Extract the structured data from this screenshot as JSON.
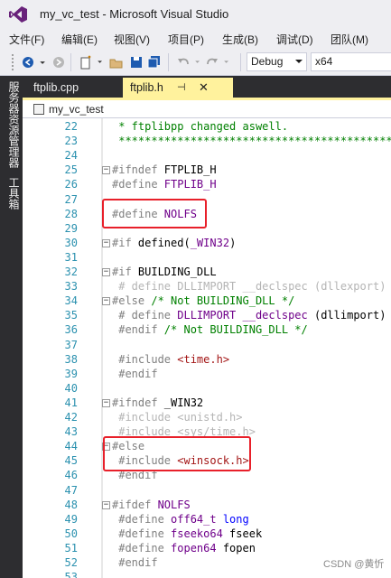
{
  "window": {
    "title": "my_vc_test - Microsoft Visual Studio"
  },
  "menu": [
    {
      "label": "文件(F)"
    },
    {
      "label": "编辑(E)"
    },
    {
      "label": "视图(V)"
    },
    {
      "label": "项目(P)"
    },
    {
      "label": "生成(B)"
    },
    {
      "label": "调试(D)"
    },
    {
      "label": "团队(M)"
    }
  ],
  "toolbar": {
    "config_value": "Debug",
    "platform_value": "x64"
  },
  "side_tabs": [
    {
      "label": "服务器资源管理器"
    },
    {
      "label": "工具箱"
    }
  ],
  "tabs": [
    {
      "label": "ftplib.cpp"
    },
    {
      "label": "ftplib.h"
    }
  ],
  "nav": {
    "scope": "my_vc_test"
  },
  "colors": {
    "tab_active": "#fff29d",
    "highlight_box": "#e8202a",
    "line_number": "#2b91af"
  },
  "code": [
    {
      "n": "22",
      "fold": "",
      "tokens": [
        {
          "c": "cm",
          "t": " * ftplibpp changed aswell."
        }
      ]
    },
    {
      "n": "23",
      "fold": "",
      "tokens": [
        {
          "c": "cm",
          "t": " ****************************************************"
        }
      ]
    },
    {
      "n": "24",
      "fold": "",
      "tokens": []
    },
    {
      "n": "25",
      "fold": "−",
      "tokens": [
        {
          "c": "pp",
          "t": "#ifndef "
        },
        {
          "c": "plain",
          "t": "FTPLIB_H"
        }
      ]
    },
    {
      "n": "26",
      "fold": "",
      "tokens": [
        {
          "c": "pp",
          "t": "#define "
        },
        {
          "c": "id",
          "t": "FTPLIB_H"
        }
      ]
    },
    {
      "n": "27",
      "fold": "",
      "tokens": []
    },
    {
      "n": "28",
      "fold": "",
      "tokens": [
        {
          "c": "pp",
          "t": "#define "
        },
        {
          "c": "id",
          "t": "NOLFS"
        }
      ]
    },
    {
      "n": "29",
      "fold": "",
      "tokens": []
    },
    {
      "n": "30",
      "fold": "−",
      "tokens": [
        {
          "c": "pp",
          "t": "#if "
        },
        {
          "c": "plain",
          "t": "defined("
        },
        {
          "c": "id",
          "t": "_WIN32"
        },
        {
          "c": "plain",
          "t": ")"
        }
      ]
    },
    {
      "n": "31",
      "fold": "",
      "tokens": []
    },
    {
      "n": "32",
      "fold": "−",
      "tokens": [
        {
          "c": "pp",
          "t": "#if "
        },
        {
          "c": "plain",
          "t": "BUILDING_DLL"
        }
      ]
    },
    {
      "n": "33",
      "fold": "",
      "tokens": [
        {
          "c": "dim",
          "t": " # define DLLIMPORT __declspec (dllexport)"
        }
      ]
    },
    {
      "n": "34",
      "fold": "−",
      "tokens": [
        {
          "c": "pp",
          "t": "#else "
        },
        {
          "c": "cm",
          "t": "/* Not BUILDING_DLL */"
        }
      ]
    },
    {
      "n": "35",
      "fold": "",
      "tokens": [
        {
          "c": "pp",
          "t": " # define "
        },
        {
          "c": "id",
          "t": "DLLIMPORT __declspec"
        },
        {
          "c": "plain",
          "t": " (dllimport)"
        }
      ]
    },
    {
      "n": "36",
      "fold": "",
      "tokens": [
        {
          "c": "pp",
          "t": " #endif "
        },
        {
          "c": "cm",
          "t": "/* Not BUILDING_DLL */"
        }
      ]
    },
    {
      "n": "37",
      "fold": "",
      "tokens": []
    },
    {
      "n": "38",
      "fold": "",
      "tokens": [
        {
          "c": "pp",
          "t": " #include "
        },
        {
          "c": "inc",
          "t": "<time.h>"
        }
      ]
    },
    {
      "n": "39",
      "fold": "",
      "tokens": [
        {
          "c": "pp",
          "t": " #endif"
        }
      ]
    },
    {
      "n": "40",
      "fold": "",
      "tokens": []
    },
    {
      "n": "41",
      "fold": "−",
      "tokens": [
        {
          "c": "pp",
          "t": "#ifndef "
        },
        {
          "c": "plain",
          "t": "_WIN32"
        }
      ]
    },
    {
      "n": "42",
      "fold": "",
      "tokens": [
        {
          "c": "dim",
          "t": " #include <unistd.h>"
        }
      ]
    },
    {
      "n": "43",
      "fold": "",
      "tokens": [
        {
          "c": "dim",
          "t": " #include <sys/time.h>"
        }
      ]
    },
    {
      "n": "44",
      "fold": "−",
      "tokens": [
        {
          "c": "pp",
          "t": "#else"
        }
      ]
    },
    {
      "n": "45",
      "fold": "",
      "tokens": [
        {
          "c": "pp",
          "t": " #include "
        },
        {
          "c": "inc",
          "t": "<winsock.h>"
        }
      ]
    },
    {
      "n": "46",
      "fold": "",
      "tokens": [
        {
          "c": "pp",
          "t": " #endif"
        }
      ]
    },
    {
      "n": "47",
      "fold": "",
      "tokens": []
    },
    {
      "n": "48",
      "fold": "−",
      "tokens": [
        {
          "c": "pp",
          "t": "#ifdef "
        },
        {
          "c": "id",
          "t": "NOLFS"
        }
      ]
    },
    {
      "n": "49",
      "fold": "",
      "tokens": [
        {
          "c": "pp",
          "t": " #define "
        },
        {
          "c": "id",
          "t": "off64_t"
        },
        {
          "c": "kw",
          "t": " long"
        }
      ]
    },
    {
      "n": "50",
      "fold": "",
      "tokens": [
        {
          "c": "pp",
          "t": " #define "
        },
        {
          "c": "id",
          "t": "fseeko64"
        },
        {
          "c": "plain",
          "t": " fseek"
        }
      ]
    },
    {
      "n": "51",
      "fold": "",
      "tokens": [
        {
          "c": "pp",
          "t": " #define "
        },
        {
          "c": "id",
          "t": "fopen64"
        },
        {
          "c": "plain",
          "t": " fopen"
        }
      ]
    },
    {
      "n": "52",
      "fold": "",
      "tokens": [
        {
          "c": "pp",
          "t": " #endif"
        }
      ]
    },
    {
      "n": "53",
      "fold": "",
      "tokens": []
    }
  ],
  "watermark": "CSDN @黄忻"
}
